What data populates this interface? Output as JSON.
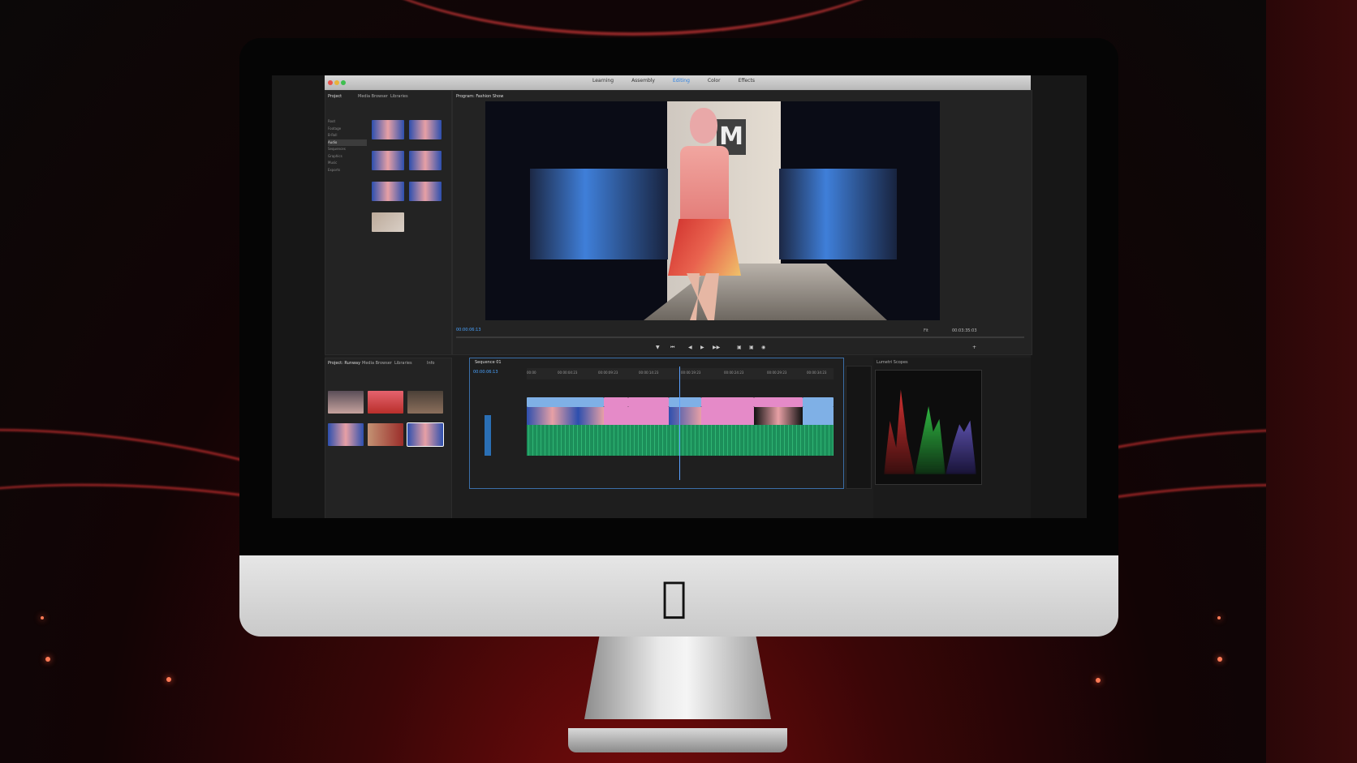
{
  "workspace_tabs": [
    "Learning",
    "Assembly",
    "Editing",
    "Color",
    "Effects"
  ],
  "active_workspace": "Editing",
  "project_panel": {
    "tabs": [
      "Project",
      "Media Browser",
      "Libraries"
    ],
    "tree": [
      "Root",
      "Footage",
      "B-Roll",
      "Audio",
      "Sequences",
      "Graphics",
      "Music",
      "Exports"
    ]
  },
  "program_monitor": {
    "title": "Program: Fashion Show",
    "timecode_left": "00:00:06:13",
    "timecode_right": "00:03:35:03",
    "zoom": "Fit"
  },
  "media_panel": {
    "tabs": [
      "Project: Runway",
      "Media Browser",
      "Libraries",
      "Info"
    ]
  },
  "timeline": {
    "title": "Sequence 01",
    "timecode": "00:00:06:13",
    "ruler": [
      "00:00",
      "00:00:04:23",
      "00:00:09:23",
      "00:00:14:23",
      "00:00:19:23",
      "00:00:24:23",
      "00:00:29:23",
      "00:00:34:23"
    ]
  },
  "scopes_panel": {
    "title": "Lumetri Scopes"
  },
  "colors": {
    "accent": "#2a7fe0",
    "clip_blue": "#7fb0e6",
    "clip_pink": "#e58ac8",
    "audio_green": "#2fb574"
  }
}
